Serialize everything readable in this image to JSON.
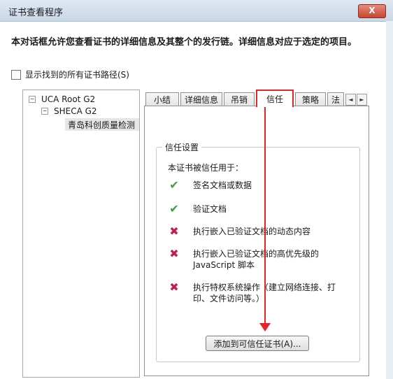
{
  "window": {
    "title": "证书查看程序",
    "close_label": "X"
  },
  "intro": "本对话框允许您查看证书的详细信息及其整个的发行链。详细信息对应于选定的项目。",
  "show_all_paths_label": "显示找到的所有证书路径(S)",
  "tree": [
    {
      "label": "UCA Root G2",
      "toggle": "−"
    },
    {
      "label": "SHECA G2",
      "toggle": "−"
    },
    {
      "label": "青岛科创质量检测"
    }
  ],
  "tabs": [
    {
      "label": "小结"
    },
    {
      "label": "详细信息"
    },
    {
      "label": "吊销"
    },
    {
      "label": "信任"
    },
    {
      "label": "策略"
    },
    {
      "label": "法"
    }
  ],
  "tab_scroll": {
    "left": "◄",
    "right": "►"
  },
  "trust": {
    "group_title": "信任设置",
    "trusted_for": "本证书被信任用于：",
    "items": [
      {
        "icon": "✔",
        "text": "签名文档或数据"
      },
      {
        "icon": "✔",
        "text": "验证文档"
      },
      {
        "icon": "✖",
        "text": "执行嵌入已验证文档的动态内容"
      },
      {
        "icon": "✖",
        "text": "执行嵌入已验证文档的高优先级的JavaScript 脚本"
      },
      {
        "icon": "✖",
        "text": "执行特权系统操作（建立网络连接、打印、文件访问等。）"
      }
    ],
    "add_button": "添加到可信任证书(A)..."
  },
  "colors": {
    "highlight": "#e3242b",
    "allowed": "#39a33b",
    "denied": "#c21e4f"
  }
}
